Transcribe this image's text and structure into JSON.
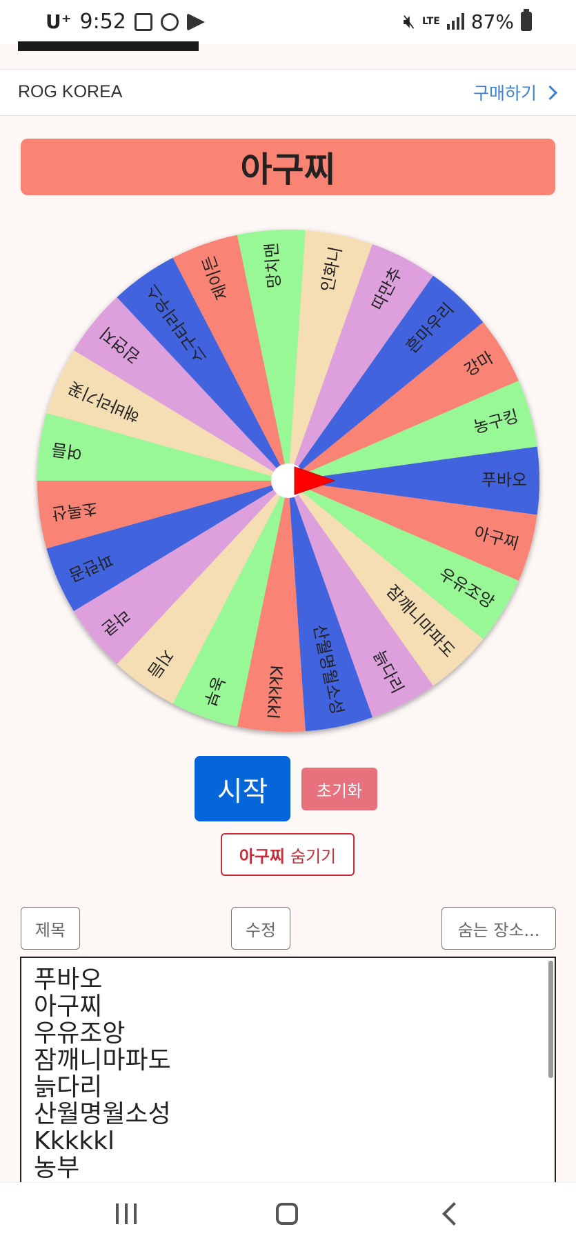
{
  "status_bar": {
    "carrier": "U⁺",
    "time": "9:52",
    "network": "LTE",
    "battery": "87%"
  },
  "ad": {
    "brand": "ROG KOREA",
    "cta": "구매하기"
  },
  "result_title": "아구찌",
  "wheel": {
    "colors": [
      "#f98474",
      "#98f895",
      "#f5deb3",
      "#dda0dd",
      "#4363de"
    ],
    "segments": [
      "푸바오",
      "아구찌",
      "우유조앙",
      "잠깨니마파도",
      "늙다리",
      "산월명월소성",
      "Kkkkkl",
      "농부",
      "지듬",
      "라쿤",
      "파란곰",
      "초록산",
      "여름",
      "해바라기꽃",
      "김연지",
      "스구타리우스",
      "제이든",
      "망치맨",
      "인화니",
      "따만추",
      "흔마우리",
      "강마",
      "농구킹"
    ]
  },
  "buttons": {
    "start": "시작",
    "reset": "초기화",
    "hide_bold": "아구찌",
    "hide_rest": "숨기기",
    "title": "제목",
    "edit": "수정",
    "hiding_place": "숨는 장소..."
  },
  "list": [
    "푸바오",
    "아구찌",
    "우유조앙",
    "잠깨니마파도",
    "늙다리",
    "산월명월소성",
    "Kkkkkl",
    "농부"
  ]
}
